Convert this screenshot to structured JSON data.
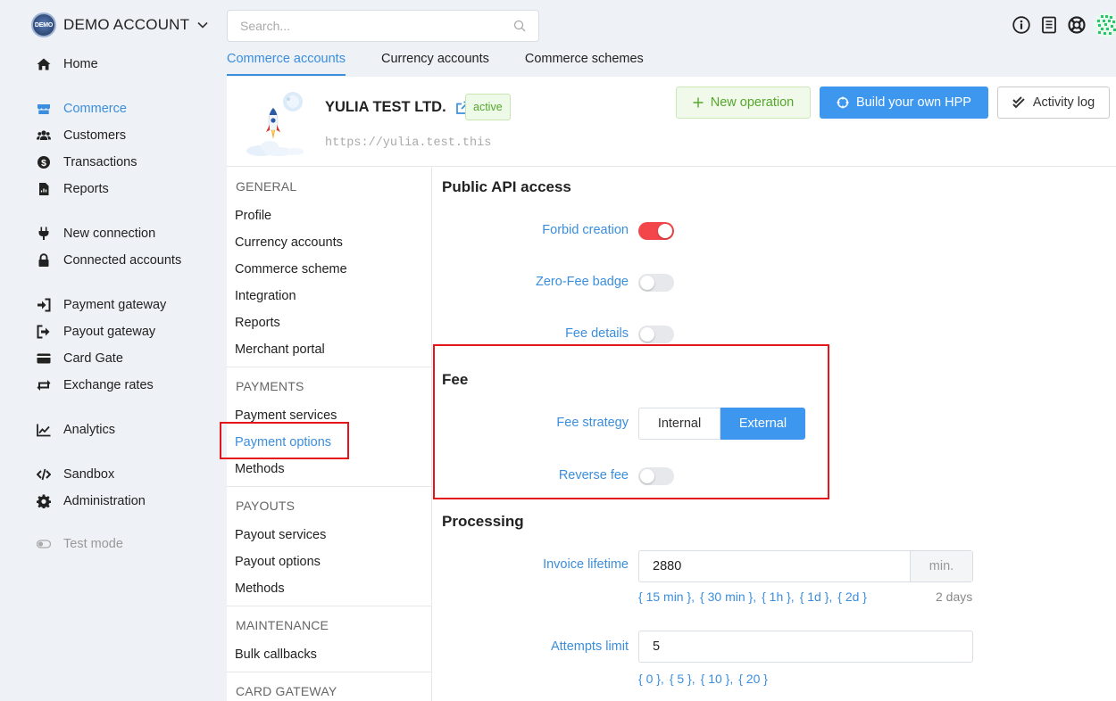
{
  "account": {
    "logo_text": "DEMO",
    "name": "DEMO ACCOUNT"
  },
  "sidebar": {
    "items": [
      {
        "label": "Home",
        "icon": "home-icon"
      },
      {
        "label": "Commerce",
        "icon": "store-icon",
        "active": true
      },
      {
        "label": "Customers",
        "icon": "users-icon"
      },
      {
        "label": "Transactions",
        "icon": "dollar-icon"
      },
      {
        "label": "Reports",
        "icon": "file-icon"
      },
      {
        "label": "New connection",
        "icon": "plug-icon"
      },
      {
        "label": "Connected accounts",
        "icon": "lock-icon"
      },
      {
        "label": "Payment gateway",
        "icon": "sign-in-icon"
      },
      {
        "label": "Payout gateway",
        "icon": "sign-out-icon"
      },
      {
        "label": "Card Gate",
        "icon": "card-icon"
      },
      {
        "label": "Exchange rates",
        "icon": "exchange-icon"
      },
      {
        "label": "Analytics",
        "icon": "chart-icon"
      },
      {
        "label": "Sandbox",
        "icon": "code-icon"
      },
      {
        "label": "Administration",
        "icon": "gear-icon"
      },
      {
        "label": "Test mode",
        "icon": "toggle-icon"
      }
    ]
  },
  "search": {
    "placeholder": "Search..."
  },
  "tabs": [
    "Commerce accounts",
    "Currency accounts",
    "Commerce schemes"
  ],
  "merchant": {
    "name": "YULIA TEST LTD.",
    "status": "active",
    "url": "https://yulia.test.this"
  },
  "buttons": {
    "new_operation": "New operation",
    "build_hpp": "Build your own HPP",
    "activity_log": "Activity log"
  },
  "menu": {
    "general": "GENERAL",
    "general_items": [
      "Profile",
      "Currency accounts",
      "Commerce scheme",
      "Integration",
      "Reports",
      "Merchant portal"
    ],
    "payments": "PAYMENTS",
    "payments_items": [
      "Payment services",
      "Payment options",
      "Methods"
    ],
    "payouts": "PAYOUTS",
    "payouts_items": [
      "Payout services",
      "Payout options",
      "Methods"
    ],
    "maintenance": "MAINTENANCE",
    "maintenance_items": [
      "Bulk callbacks"
    ],
    "card_gateway": "CARD GATEWAY"
  },
  "content": {
    "public_api": {
      "title": "Public API access",
      "forbid_creation": {
        "label": "Forbid creation",
        "on": true
      },
      "zero_fee_badge": {
        "label": "Zero-Fee badge",
        "on": false
      },
      "fee_details": {
        "label": "Fee details",
        "on": false
      }
    },
    "fee": {
      "title": "Fee",
      "strategy_label": "Fee strategy",
      "strategy_options": [
        "Internal",
        "External"
      ],
      "strategy_selected": "External",
      "reverse_fee": {
        "label": "Reverse fee",
        "on": false
      }
    },
    "processing": {
      "title": "Processing",
      "invoice_lifetime": {
        "label": "Invoice lifetime",
        "value": "2880",
        "suffix": "min.",
        "quick": [
          "{ 15 min },",
          "{ 30 min },",
          "{ 1h },",
          "{ 1d },",
          "{ 2d }"
        ],
        "hint": "2 days"
      },
      "attempts_limit": {
        "label": "Attempts limit",
        "value": "5",
        "quick": [
          "{ 0 },",
          "{ 5 },",
          "{ 10 },",
          "{ 20 }"
        ]
      }
    }
  },
  "colors": {
    "accent": "#3b8edd",
    "danger": "#f2464a",
    "success": "#56a72c",
    "annotation": "#e4161b"
  }
}
